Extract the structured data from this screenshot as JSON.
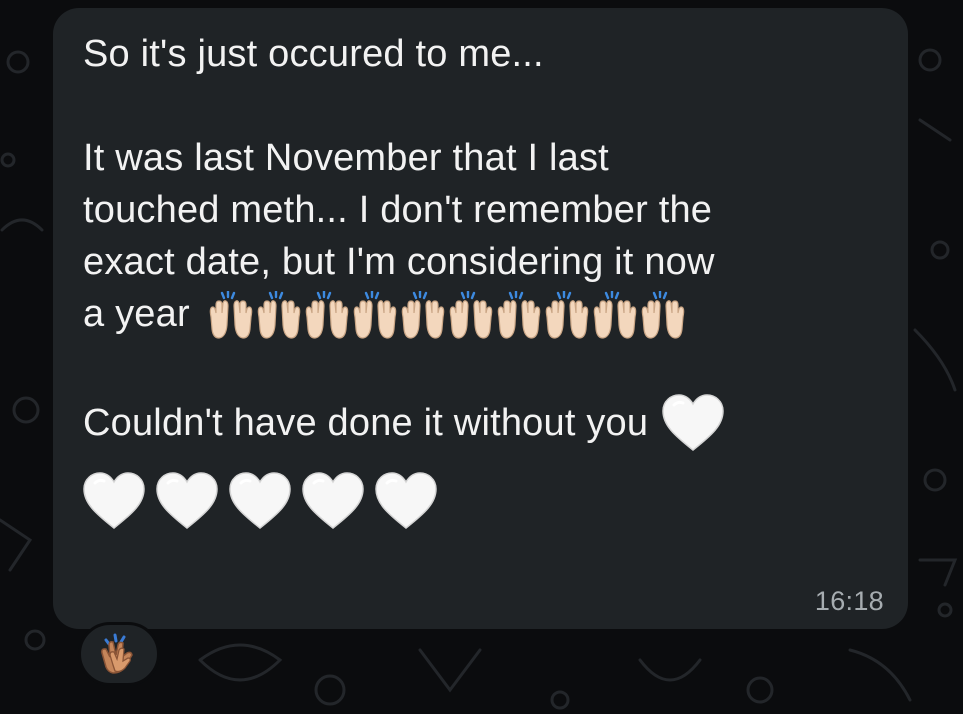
{
  "message": {
    "line1": "So it's just occured to me...",
    "line2": "It was last November that I last",
    "line3": "touched meth... I don't remember the",
    "line4": "exact date, but I'm considering it now",
    "line5_text": "a year",
    "line5_emoji": "raising-hands-emoji",
    "line5_emoji_count": 10,
    "line6": "Couldn't have done it without you",
    "line6_emoji": "white-heart-emoji",
    "heart_row_count": 5,
    "timestamp": "16:18"
  },
  "reaction": {
    "emoji": "clapping-hands-emoji"
  },
  "colors": {
    "background": "#0b0c0e",
    "bubble": "#1f2326",
    "text": "#f2f2f2",
    "timestamp": "#a6acb0",
    "skin": "#f3d7bd",
    "heart": "#f7f7f7"
  }
}
